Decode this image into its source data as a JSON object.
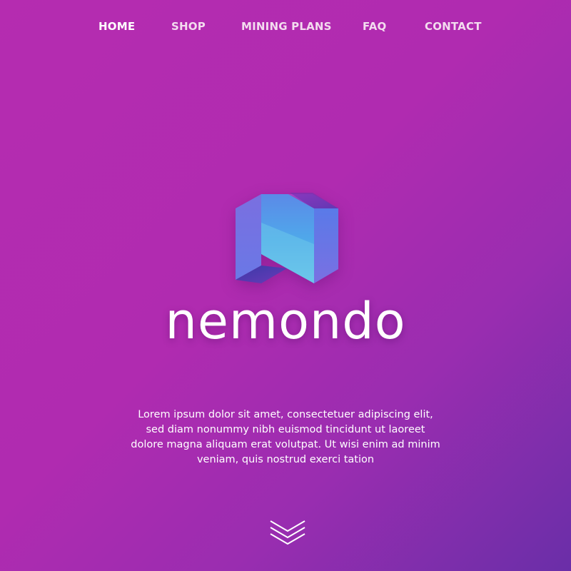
{
  "nav": {
    "items": [
      {
        "label": "HOME",
        "active": true
      },
      {
        "label": "SHOP",
        "active": false
      },
      {
        "label": "MINING PLANS",
        "active": false
      },
      {
        "label": "FAQ",
        "active": false
      },
      {
        "label": "CONTACT",
        "active": false
      }
    ]
  },
  "hero": {
    "logo_icon": "nemondo-cube-logo-icon",
    "brand_name": "nemondo",
    "description": "Lorem ipsum dolor sit amet, consectetuer adipiscing elit, sed diam nonummy nibh euismod tincidunt ut laoreet dolore magna aliquam erat volutpat. Ut wisi enim ad minim veniam, quis nostrud exerci tation",
    "scroll_icon": "chevrons-down-icon"
  },
  "colors": {
    "background_start": "#b52cb0",
    "background_end": "#6a2ea8",
    "text": "#ffffff"
  }
}
